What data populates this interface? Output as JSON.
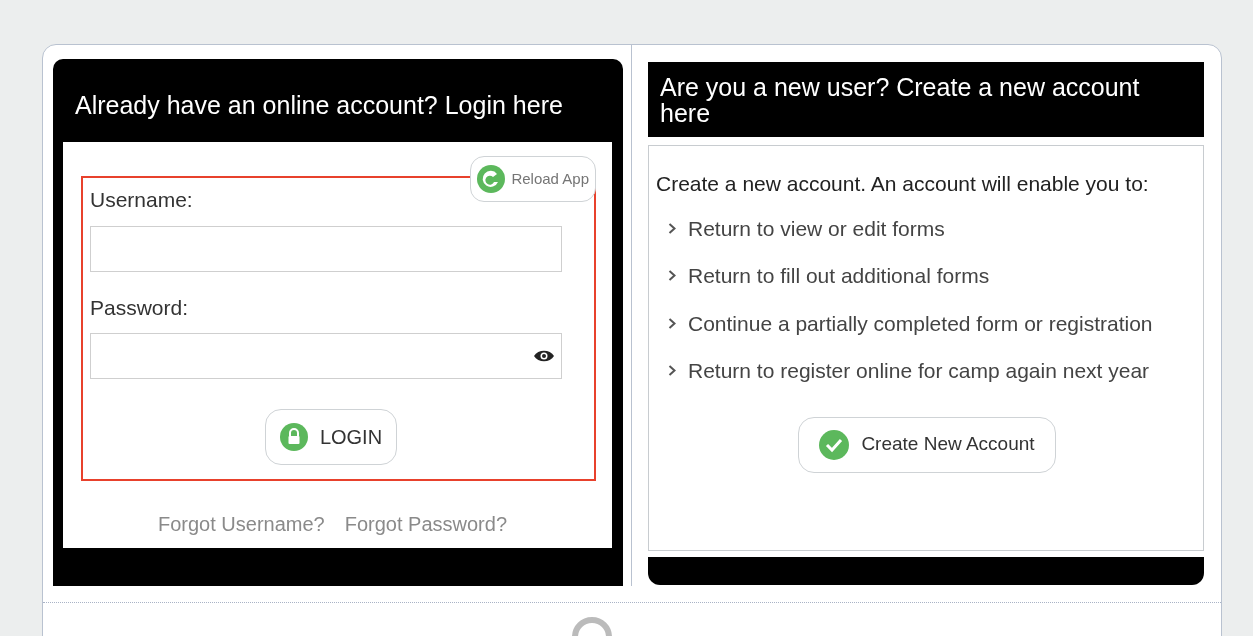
{
  "login": {
    "title": "Already have an online account? Login here",
    "reload_button": "Reload App",
    "username_label": "Username:",
    "password_label": "Password:",
    "login_button": "LOGIN",
    "links": [
      "Forgot Username?",
      "Forgot Password?"
    ]
  },
  "register": {
    "title": "Are you a new user? Create a new account here",
    "intro": "Create a new account. An account will enable you to:",
    "benefits": [
      "Return to view or edit forms",
      "Return to fill out additional forms",
      "Continue a partially completed form or registration",
      "Return to register online for camp again next year"
    ],
    "create_button": "Create New Account"
  }
}
